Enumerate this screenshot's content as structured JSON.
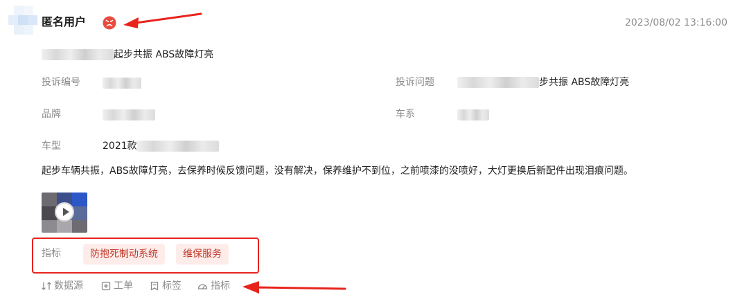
{
  "header": {
    "username": "匿名用户",
    "timestamp": "2023/08/02 13:16:00",
    "status_icon": "sad-face-icon",
    "status_color": "#e84c3d"
  },
  "complaint": {
    "title_suffix": "起步共振 ABS故障灯亮",
    "fields": {
      "number_label": "投诉编号",
      "issue_label": "投诉问题",
      "issue_value_suffix": "步共振 ABS故障灯亮",
      "brand_label": "品牌",
      "series_label": "车系",
      "model_label": "车型",
      "model_value_prefix": "2021款"
    },
    "description": "起步车辆共振，ABS故障灯亮，去保养时候反馈问题，没有解决，保养维护不到位，之前喷漆的没喷好，大灯更换后新配件出现泪痕问题。"
  },
  "indicators": {
    "label": "指标",
    "tags": [
      "防抱死制动系统",
      "维保服务"
    ],
    "tag_color": "#c0392b",
    "tag_bg": "#fdecea"
  },
  "actions": {
    "datasource": "数据源",
    "workorder": "工单",
    "tags": "标签",
    "indicator": "指标"
  },
  "colors": {
    "annotation_red": "#e8231c",
    "muted_text": "#8a8a8a"
  }
}
